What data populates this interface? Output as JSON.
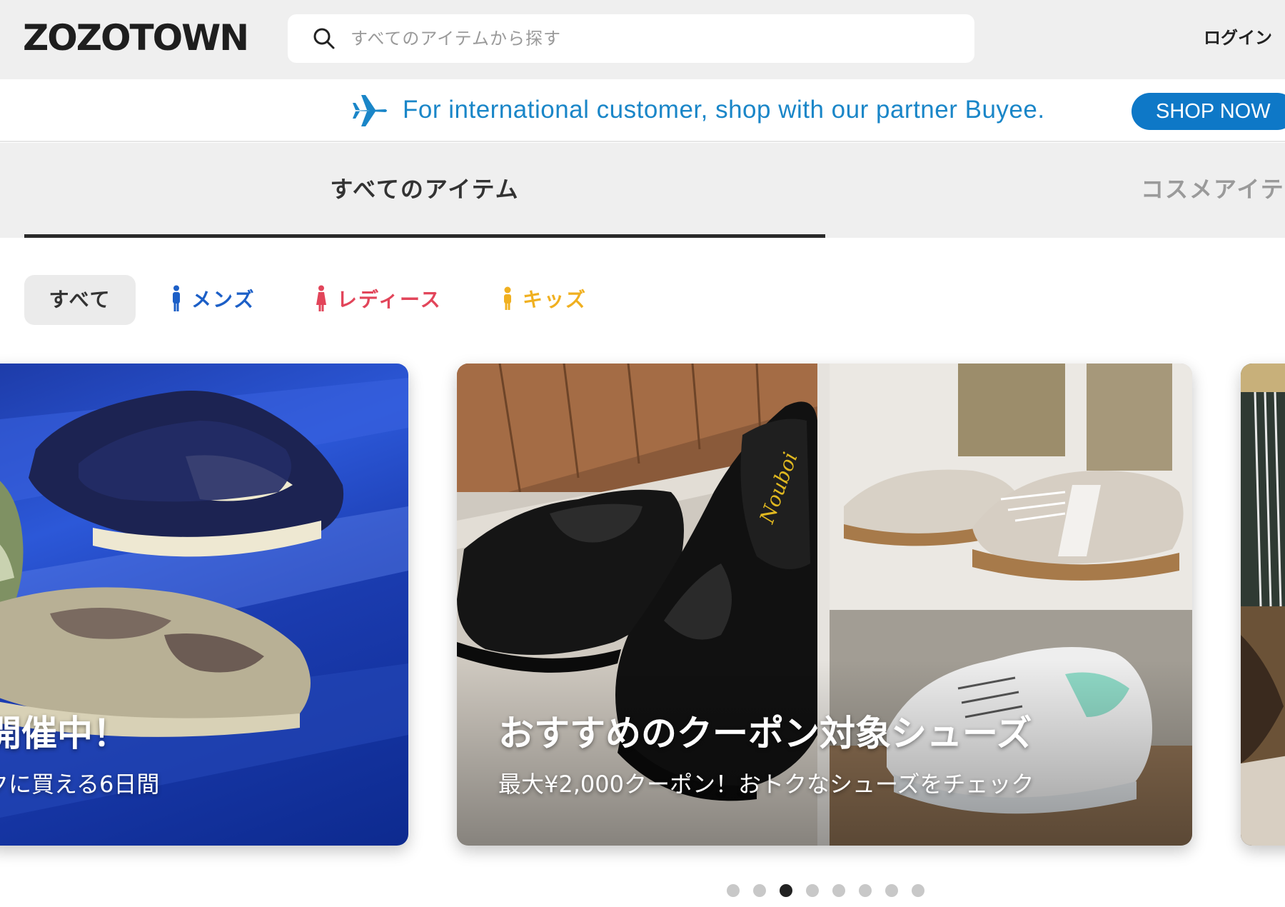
{
  "header": {
    "logo": "ZOZOTOWN",
    "search_placeholder": "すべてのアイテムから探す",
    "login": "ログイン"
  },
  "intl_banner": {
    "message": "For international customer, shop with our partner Buyee.",
    "button": "SHOP NOW",
    "accent_color": "#0e78c7"
  },
  "tabs": {
    "active": "すべてのアイテム",
    "next": "コスメアイテ"
  },
  "filters": {
    "all": "すべて",
    "men": "メンズ",
    "ladies": "レディース",
    "kids": "キッズ",
    "colors": {
      "men": "#1c5fc7",
      "ladies": "#e2455a",
      "kids": "#f0b020"
    }
  },
  "carousel": {
    "left": {
      "title": "開催中！",
      "subtitle": "クに買える6日間"
    },
    "center": {
      "title": "おすすめのクーポン対象シューズ",
      "subtitle": "最大¥2,000クーポン！おトクなシューズをチェック"
    },
    "dots_total": 8,
    "active_dot": 3
  }
}
